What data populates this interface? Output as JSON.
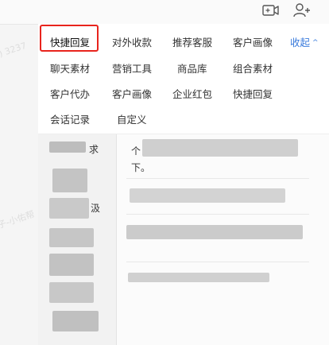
{
  "toolbar": {
    "icons": [
      "video-call-icon",
      "add-contact-icon"
    ]
  },
  "menu": {
    "rows": [
      [
        "快捷回复",
        "对外收款",
        "推荐客服",
        "客户画像"
      ],
      [
        "聊天素材",
        "营销工具",
        "商品库",
        "组合素材"
      ],
      [
        "客户代办",
        "客户画像",
        "企业红包",
        "快捷回复"
      ],
      [
        "会话记录",
        "自定义"
      ]
    ],
    "active": "快捷回复",
    "active_color": "#e8241d",
    "collapse_label": "收起",
    "collapse_icon": "chevron-up-icon",
    "accent": "#3a7bdc"
  },
  "content": {
    "left_fragments": [
      "求",
      "汲"
    ],
    "right_fragments": [
      "个",
      "下。"
    ]
  }
}
